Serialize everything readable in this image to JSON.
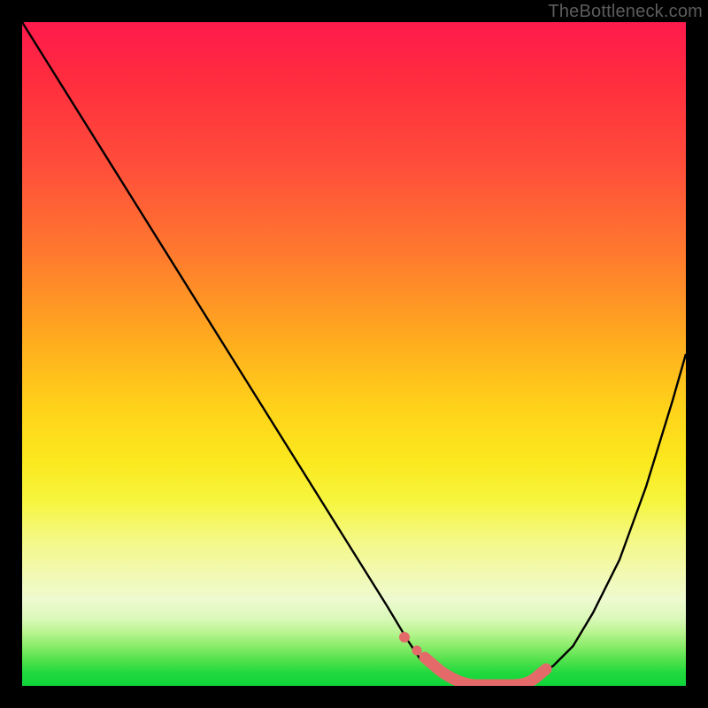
{
  "watermark": "TheBottleneck.com",
  "colors": {
    "curve": "#000000",
    "marker": "#e46a6a",
    "background_top": "#ff1a4d",
    "background_bottom": "#0ed53a",
    "frame": "#000000"
  },
  "chart_data": {
    "type": "line",
    "title": "",
    "xlabel": "",
    "ylabel": "",
    "xlim": [
      0,
      100
    ],
    "ylim": [
      0,
      100
    ],
    "grid": false,
    "legend": false,
    "series": [
      {
        "name": "bottleneck-curve",
        "x": [
          0,
          5,
          10,
          15,
          20,
          25,
          30,
          35,
          40,
          45,
          50,
          55,
          58,
          60,
          63,
          66,
          70,
          74,
          77,
          80,
          83,
          86,
          90,
          94,
          98,
          100
        ],
        "values": [
          100,
          92,
          84,
          76,
          68,
          60,
          52,
          44,
          36,
          28,
          20,
          12,
          7,
          4,
          2,
          1,
          0,
          0,
          1,
          3,
          6,
          11,
          19,
          30,
          43,
          50
        ]
      }
    ],
    "annotations": [
      {
        "name": "optimal-flat-region",
        "type": "segment",
        "x": [
          58,
          77
        ],
        "y": [
          0,
          0
        ],
        "note": "thick salmon highlight along curve minimum, with two small dots on the left approach"
      }
    ]
  }
}
